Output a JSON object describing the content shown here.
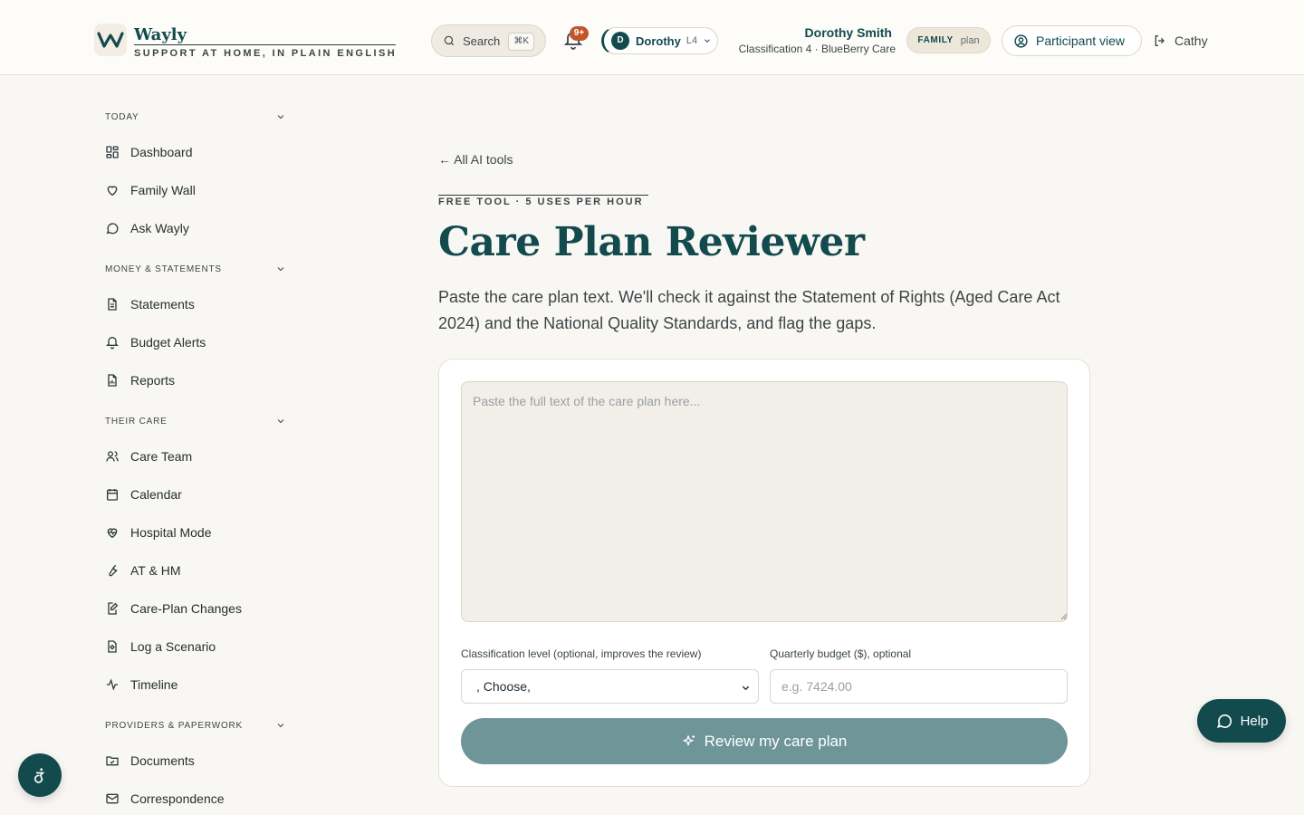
{
  "colors": {
    "brand": "#124a4e",
    "accent": "#c1552b",
    "button_disabled": "#6e9598",
    "background": "#f9f7f3"
  },
  "header": {
    "logo_name": "Wayly",
    "logo_tagline": "SUPPORT AT HOME, IN PLAIN ENGLISH",
    "search_label": "Search",
    "search_shortcut": "⌘K",
    "notifications_badge": "9+",
    "switcher": {
      "avatar_initial": "D",
      "name": "Dorothy",
      "level": "L4"
    },
    "participant_name": "Dorothy Smith",
    "participant_sub": "Classification 4 · BlueBerry Care",
    "plan_tier": "FAMILY",
    "plan_word": "plan",
    "participant_view_label": "Participant view",
    "user_name": "Cathy"
  },
  "sidebar": {
    "sections": [
      {
        "label": "TODAY",
        "items": [
          {
            "label": "Dashboard",
            "icon": "dashboard-icon"
          },
          {
            "label": "Family Wall",
            "icon": "heart-icon"
          },
          {
            "label": "Ask Wayly",
            "icon": "chat-icon"
          }
        ]
      },
      {
        "label": "MONEY & STATEMENTS",
        "items": [
          {
            "label": "Statements",
            "icon": "document-icon"
          },
          {
            "label": "Budget Alerts",
            "icon": "bell-icon"
          },
          {
            "label": "Reports",
            "icon": "report-icon"
          }
        ]
      },
      {
        "label": "THEIR CARE",
        "items": [
          {
            "label": "Care Team",
            "icon": "users-icon"
          },
          {
            "label": "Calendar",
            "icon": "calendar-icon"
          },
          {
            "label": "Hospital Mode",
            "icon": "heart-pulse-icon"
          },
          {
            "label": "AT & HM",
            "icon": "wrench-icon"
          },
          {
            "label": "Care-Plan Changes",
            "icon": "edit-document-icon"
          },
          {
            "label": "Log a Scenario",
            "icon": "scenario-icon"
          },
          {
            "label": "Timeline",
            "icon": "activity-icon"
          }
        ]
      },
      {
        "label": "PROVIDERS & PAPERWORK",
        "items": [
          {
            "label": "Documents",
            "icon": "folder-icon"
          },
          {
            "label": "Correspondence",
            "icon": "mail-icon"
          }
        ]
      }
    ]
  },
  "main": {
    "back_link": "← All AI tools",
    "eyebrow": "FREE TOOL · 5 USES PER HOUR",
    "title": "Care Plan Reviewer",
    "intro": "Paste the care plan text. We'll check it against the Statement of Rights (Aged Care Act 2024) and the National Quality Standards, and flag the gaps.",
    "form": {
      "textarea_placeholder": "Paste the full text of the care plan here...",
      "classification_label": "Classification level (optional, improves the review)",
      "classification_value": ", Choose,",
      "budget_label": "Quarterly budget ($), optional",
      "budget_placeholder": "e.g. 7424.00",
      "submit_label": "Review my care plan"
    }
  },
  "help_label": "Help"
}
